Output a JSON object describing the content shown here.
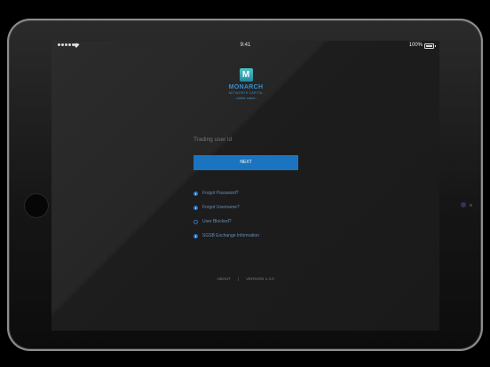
{
  "status_bar": {
    "time": "9:41",
    "battery": "100%"
  },
  "logo": {
    "name": "MONARCH",
    "subtitle": "NETWORTH CAPITAL",
    "tagline": "...better value..."
  },
  "login": {
    "user_id_placeholder": "Trading user id",
    "next_label": "NEXT"
  },
  "links": [
    {
      "label": "Forgot Password?",
      "icon": "info-icon"
    },
    {
      "label": "Forgot Username?",
      "icon": "info-icon"
    },
    {
      "label": "User Blocked?",
      "icon": "ring-icon"
    },
    {
      "label": "SGSB Exchange Information",
      "icon": "info-icon"
    }
  ],
  "footer": {
    "about": "ABOUT",
    "separator": "|",
    "version": "VERSION 1.3.0"
  },
  "colors": {
    "accent": "#1A74BF",
    "link": "#6A8DB2",
    "background": "#262626"
  }
}
